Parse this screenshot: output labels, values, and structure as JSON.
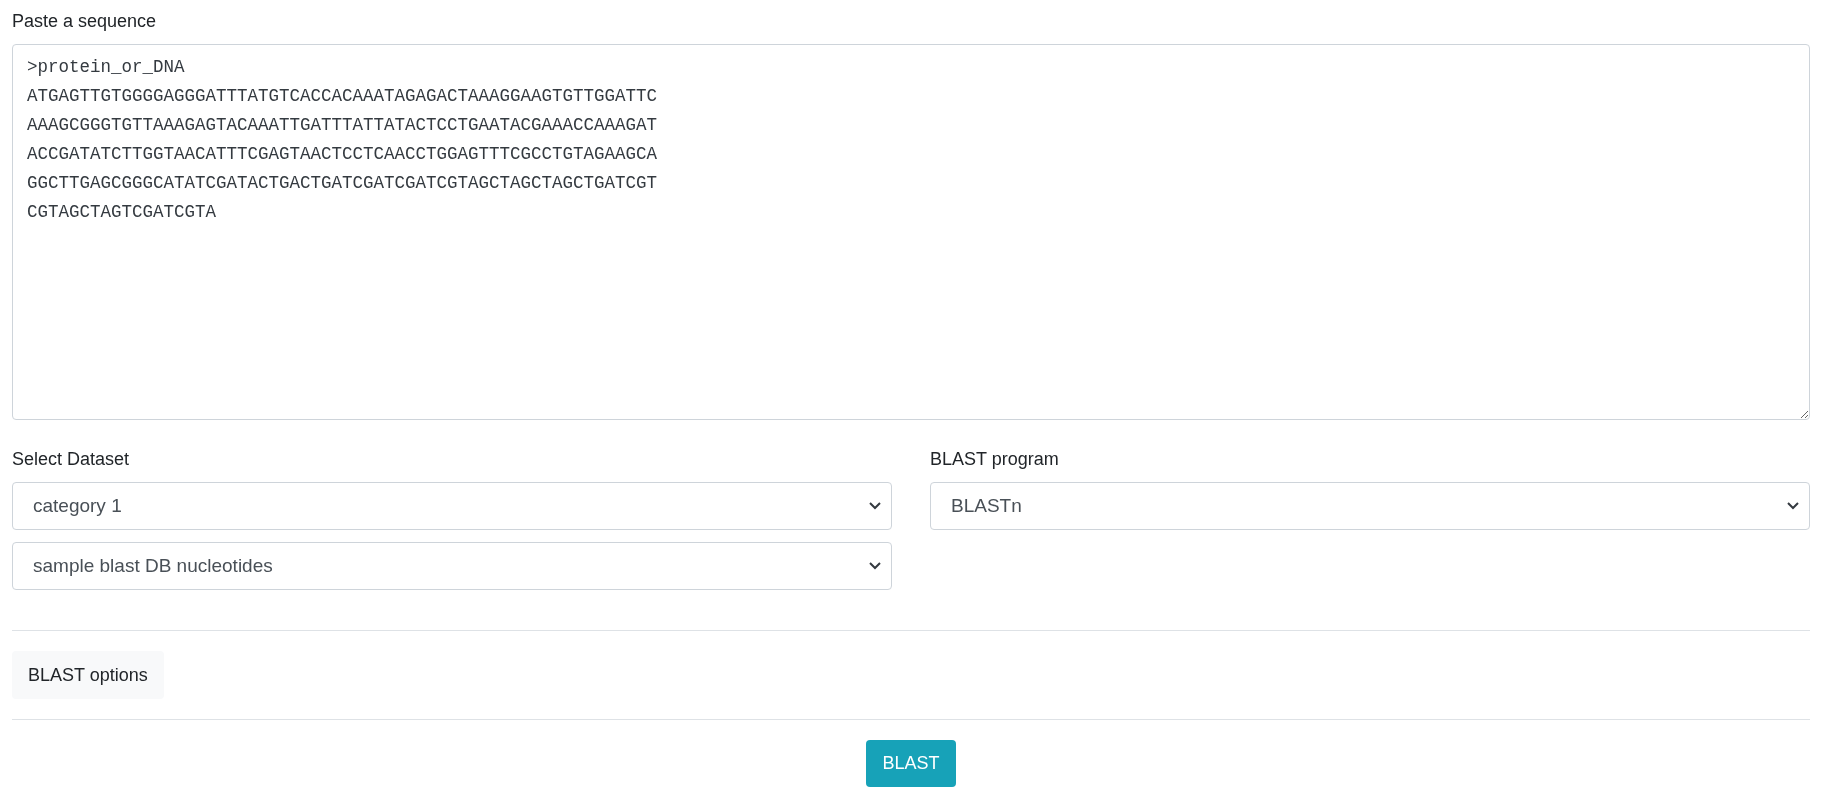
{
  "sequence": {
    "label": "Paste a sequence",
    "lines": [
      ">protein_or_DNA",
      "ATGAGTTGTGGGGAGGGATTTATGTCACCACAAATAGAGACTAAAGGAAGTGTTGGATTC",
      "AAAGCGGGTGTTAAAGAGTACAAATTGATTTATTATACTCCTGAATACGAAACCAAAGAT",
      "ACCGATATCTTGGTAACATTTCGAGTAACTCCTCAACCTGGAGTTTCGCCTGTAGAAGCA",
      "GGCTTGAGCGGGCATATCGATACTGACTGATCGATCGATCGTAGCTAGCTAGCTGATCGT",
      "CGTAGCTAGTCGATCGTA"
    ]
  },
  "dataset": {
    "label": "Select Dataset",
    "selects": [
      "category 1",
      "sample blast DB nucleotides"
    ]
  },
  "program": {
    "label": "BLAST program",
    "value": "BLASTn"
  },
  "options_button": "BLAST options",
  "submit_button": "BLAST"
}
